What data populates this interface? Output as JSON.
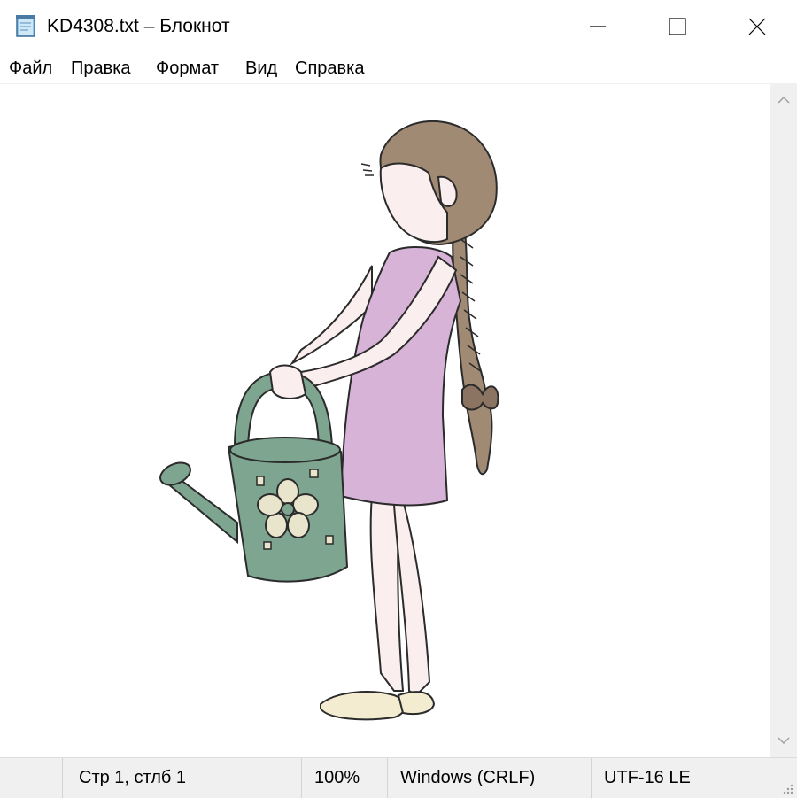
{
  "window": {
    "title": "KD4308.txt – Блокнот",
    "controls": [
      "minimize-icon",
      "maximize-icon",
      "close-icon"
    ]
  },
  "menu": {
    "items": [
      "Файл",
      "Правка",
      "Формат",
      "Вид",
      "Справка"
    ]
  },
  "editor": {
    "content_description_icon": "girl-with-watering-can-illustration",
    "colors": {
      "hair": "#a08a74",
      "dress": "#d7b3d8",
      "watering_can": "#7da58f",
      "skin": "#fbeeee",
      "shoes": "#f3ecd0"
    }
  },
  "status": {
    "position": "Стр 1, стлб 1",
    "zoom": "100%",
    "line_endings": "Windows (CRLF)",
    "encoding": "UTF-16 LE"
  }
}
